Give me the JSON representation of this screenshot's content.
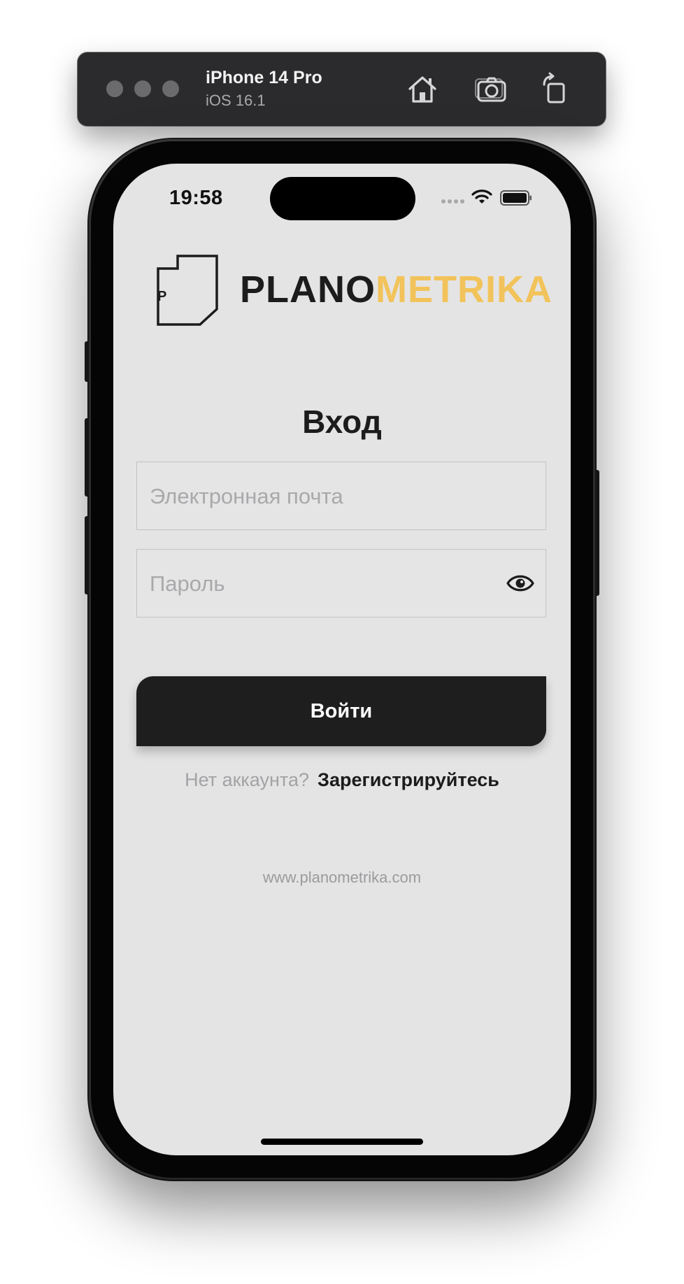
{
  "simulator": {
    "device_name": "iPhone 14 Pro",
    "os_version": "iOS 16.1",
    "toolbar_icons": [
      "home-icon",
      "screenshot-icon",
      "rotate-icon"
    ]
  },
  "status_bar": {
    "time": "19:58",
    "icons": [
      "cellular-signal-icon",
      "wifi-icon",
      "battery-icon"
    ]
  },
  "logo": {
    "mark_letter": "P",
    "text_dark": "PLANO",
    "text_accent": "METRIKA",
    "accent_color": "#f2c35a"
  },
  "login": {
    "title": "Вход",
    "email_placeholder": "Электронная почта",
    "email_value": "",
    "password_placeholder": "Пароль",
    "password_value": "",
    "password_toggle_icon": "eye-icon",
    "submit_label": "Войти"
  },
  "register": {
    "prompt": "Нет аккаунта?",
    "link": "Зарегистрируйтесь"
  },
  "footer": {
    "website": "www.planometrika.com"
  },
  "colors": {
    "screen_background": "#e4e4e5",
    "button_background": "#1e1e1f",
    "toolbar_background": "#2b2b2d"
  }
}
